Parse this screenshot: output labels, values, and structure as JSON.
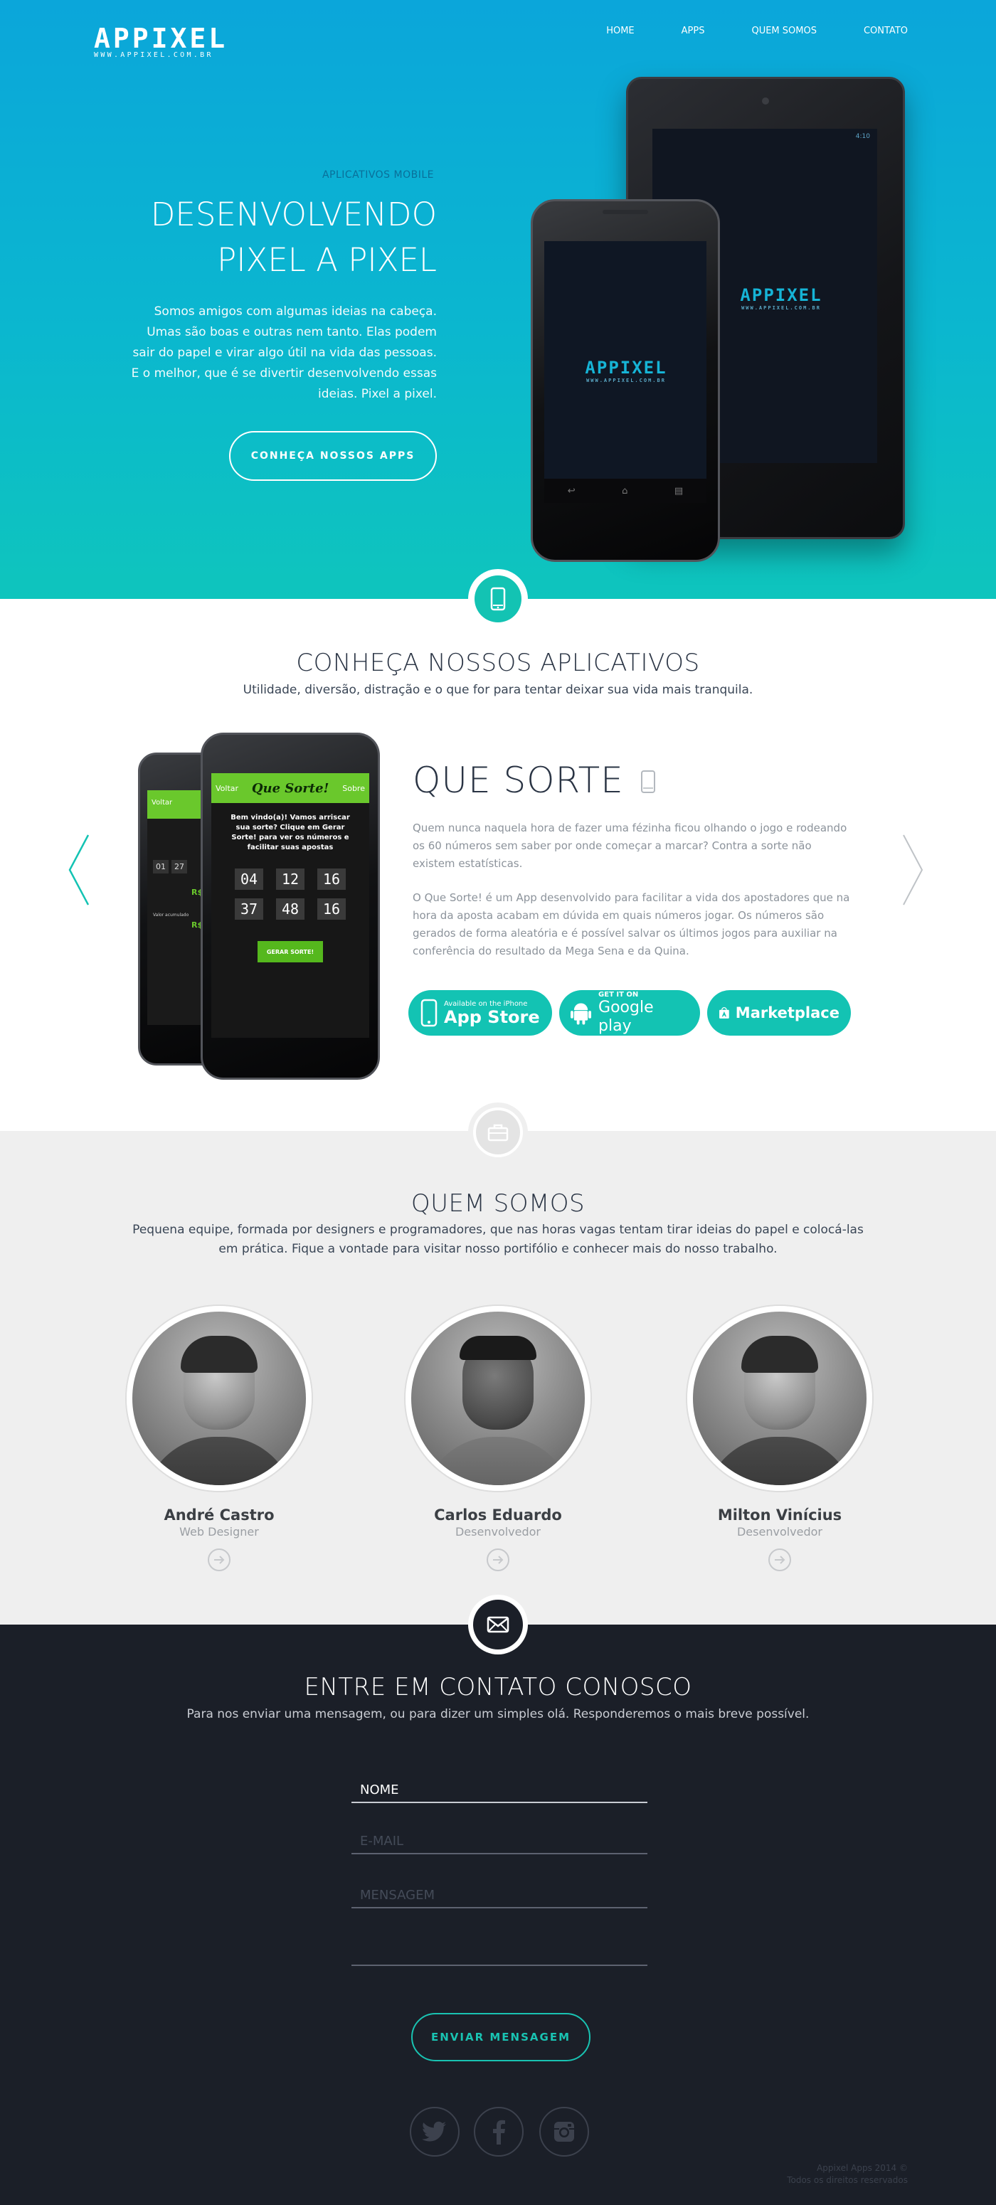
{
  "brand": {
    "logo": "APPIXEL",
    "url": "WWW.APPIXEL.COM.BR"
  },
  "nav": [
    "HOME",
    "APPS",
    "QUEM SOMOS",
    "CONTATO"
  ],
  "hero": {
    "kicker": "APLICATIVOS MOBILE",
    "title_line1": "DESENVOLVENDO",
    "title_line2": "PIXEL A PIXEL",
    "text": "Somos amigos com algumas ideias na cabeça. Umas são boas e outras nem tanto. Elas podem sair do papel e virar algo útil na vida das pessoas. E o melhor, que é se divertir desenvolvendo essas ideias. Pixel a pixel.",
    "button": "CONHEÇA NOSSOS APPS",
    "device_time": "4:10"
  },
  "apps": {
    "title": "CONHEÇA NOSSOS APLICATIVOS",
    "subtitle": "Utilidade, diversão, distração e o que for para tentar deixar sua vida mais tranquila.",
    "app_name": "QUE SORTE",
    "desc1": "Quem nunca naquela hora de fazer uma fézinha ficou olhando o jogo e rodeando os 60 números sem saber por onde começar a marcar? Contra a sorte não existem estatísticas.",
    "desc2": "O Que Sorte! é um App desenvolvido para facilitar a vida dos apostadores que na hora da aposta acabam em dúvida em quais números jogar. Os números são gerados de forma aleatória e é possível salvar os últimos jogos para auxiliar na conferência do resultado da Mega Sena e da Quina.",
    "phone_screen": {
      "back": "Voltar",
      "title": "Que Sorte!",
      "about": "Sobre",
      "welcome": "Bem vindo(a)! Vamos arriscar sua sorte? Clique em Gerar Sorte! para ver os números e facilitar suas apostas",
      "numbers": [
        "04",
        "12",
        "16",
        "37",
        "48",
        "16"
      ],
      "button": "GERAR SORTE!",
      "back_numbers": [
        "01",
        "27"
      ],
      "back_value": "R$ 1",
      "back_label": "Valor acumulado",
      "back_value2": "R$ 1"
    },
    "stores": [
      {
        "small": "Available on the iPhone",
        "big": "App Store"
      },
      {
        "small": "GET IT ON",
        "big": "Google play"
      },
      {
        "small": "",
        "big": "Marketplace"
      }
    ]
  },
  "about": {
    "title": "QUEM SOMOS",
    "subtitle": "Pequena equipe, formada por designers e programadores, que nas horas vagas tentam tirar ideias do papel e colocá-las em prática. Fique a vontade para visitar nosso portifólio e conhecer mais do nosso trabalho.",
    "members": [
      {
        "name": "André Castro",
        "role": "Web Designer"
      },
      {
        "name": "Carlos Eduardo",
        "role": "Desenvolvedor"
      },
      {
        "name": "Milton Vinícius",
        "role": "Desenvolvedor"
      }
    ]
  },
  "contact": {
    "title": "ENTRE EM  CONTATO CONOSCO",
    "subtitle": "Para nos enviar uma mensagem, ou para dizer um simples olá. Responderemos o mais breve possível.",
    "name_placeholder": "NOME",
    "email_placeholder": "E-MAIL",
    "message_placeholder": "MENSAGEM",
    "send": "ENVIAR MENSAGEM"
  },
  "footer": {
    "line1": "Appixel Apps 2014 ©",
    "line2": "Todos os direitos reservados"
  },
  "colors": {
    "accent": "#13c3b3",
    "hero_top": "#0ba6da",
    "dark": "#1b1f28",
    "grey": "#efefef"
  },
  "icons": [
    "phone-icon",
    "briefcase-icon",
    "envelope-icon",
    "twitter-icon",
    "facebook-icon",
    "instagram-icon",
    "arrow-right-icon",
    "chevron-left-icon",
    "chevron-right-icon"
  ]
}
